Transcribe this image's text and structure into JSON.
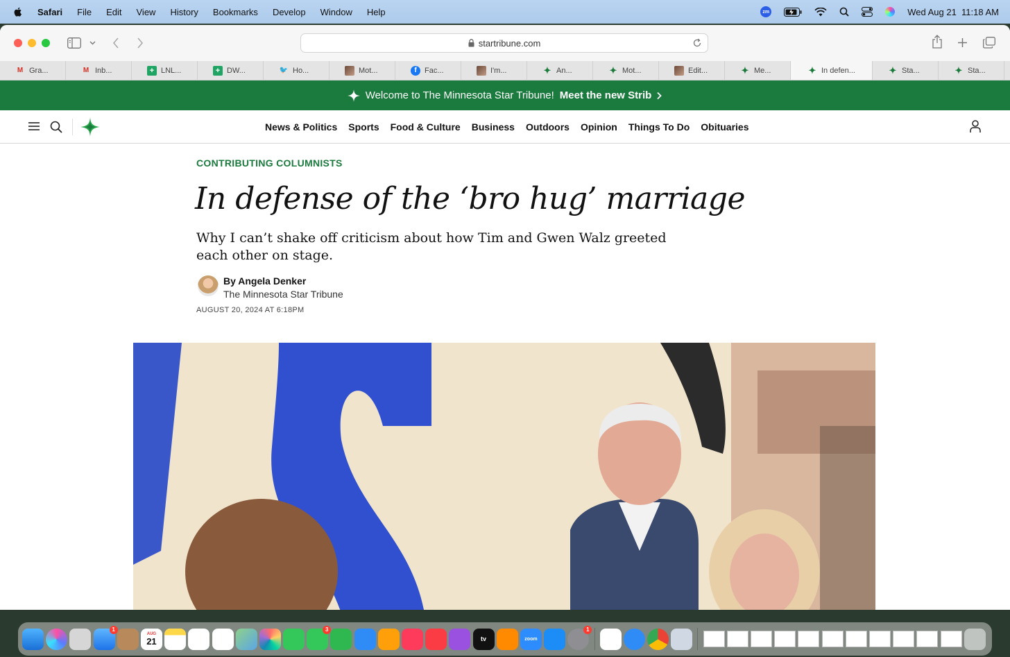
{
  "menubar": {
    "app": "Safari",
    "items": [
      "File",
      "Edit",
      "View",
      "History",
      "Bookmarks",
      "Develop",
      "Window",
      "Help"
    ],
    "zoom_badge": "zm",
    "datetime": "Wed Aug 21  11:18 AM"
  },
  "browser": {
    "url": "startribune.com",
    "tabs": [
      {
        "label": "Gra...",
        "icon": "gmail-icon",
        "glyph": "M"
      },
      {
        "label": "Inb...",
        "icon": "gmail-icon",
        "glyph": "M"
      },
      {
        "label": "LNL...",
        "icon": "sheets-icon",
        "glyph": "+"
      },
      {
        "label": "DW...",
        "icon": "sheets-icon",
        "glyph": "+"
      },
      {
        "label": "Ho...",
        "icon": "twitter-icon",
        "glyph": "🐦"
      },
      {
        "label": "Mot...",
        "icon": "photo-icon",
        "glyph": ""
      },
      {
        "label": "Fac...",
        "icon": "facebook-icon",
        "glyph": "f"
      },
      {
        "label": "I'm...",
        "icon": "photo-icon",
        "glyph": ""
      },
      {
        "label": "An...",
        "icon": "startribune-icon",
        "glyph": "✦"
      },
      {
        "label": "Mot...",
        "icon": "startribune-icon",
        "glyph": "✦"
      },
      {
        "label": "Edit...",
        "icon": "photo-icon",
        "glyph": ""
      },
      {
        "label": "Me...",
        "icon": "startribune-icon",
        "glyph": "✦"
      },
      {
        "label": "In defen...",
        "icon": "startribune-icon",
        "glyph": "✦",
        "active": true
      },
      {
        "label": "Sta...",
        "icon": "startribune-icon",
        "glyph": "✦"
      },
      {
        "label": "Sta...",
        "icon": "startribune-icon",
        "glyph": "✦"
      }
    ]
  },
  "site": {
    "welcome_text": "Welcome to The Minnesota Star Tribune!",
    "welcome_link": "Meet the new Strib",
    "nav": [
      "News & Politics",
      "Sports",
      "Food & Culture",
      "Business",
      "Outdoors",
      "Opinion",
      "Things To Do",
      "Obituaries"
    ],
    "brand_color": "#1b7a3d"
  },
  "article": {
    "kicker": "CONTRIBUTING COLUMNISTS",
    "headline": "In defense of the ‘bro hug’ marriage",
    "dek": "Why I can’t shake off criticism about how Tim and Gwen Walz greeted each other on stage.",
    "author": "By Angela Denker",
    "publication": "The Minnesota Star Tribune",
    "date": "AUGUST 20, 2024 AT 6:18PM"
  },
  "dock": {
    "calendar_month": "AUG",
    "calendar_day": "21",
    "mail_badge": "1",
    "facetime_badge": "3",
    "settings_badge": "1",
    "zoom_label": "zoom",
    "tv_label": "tv"
  }
}
